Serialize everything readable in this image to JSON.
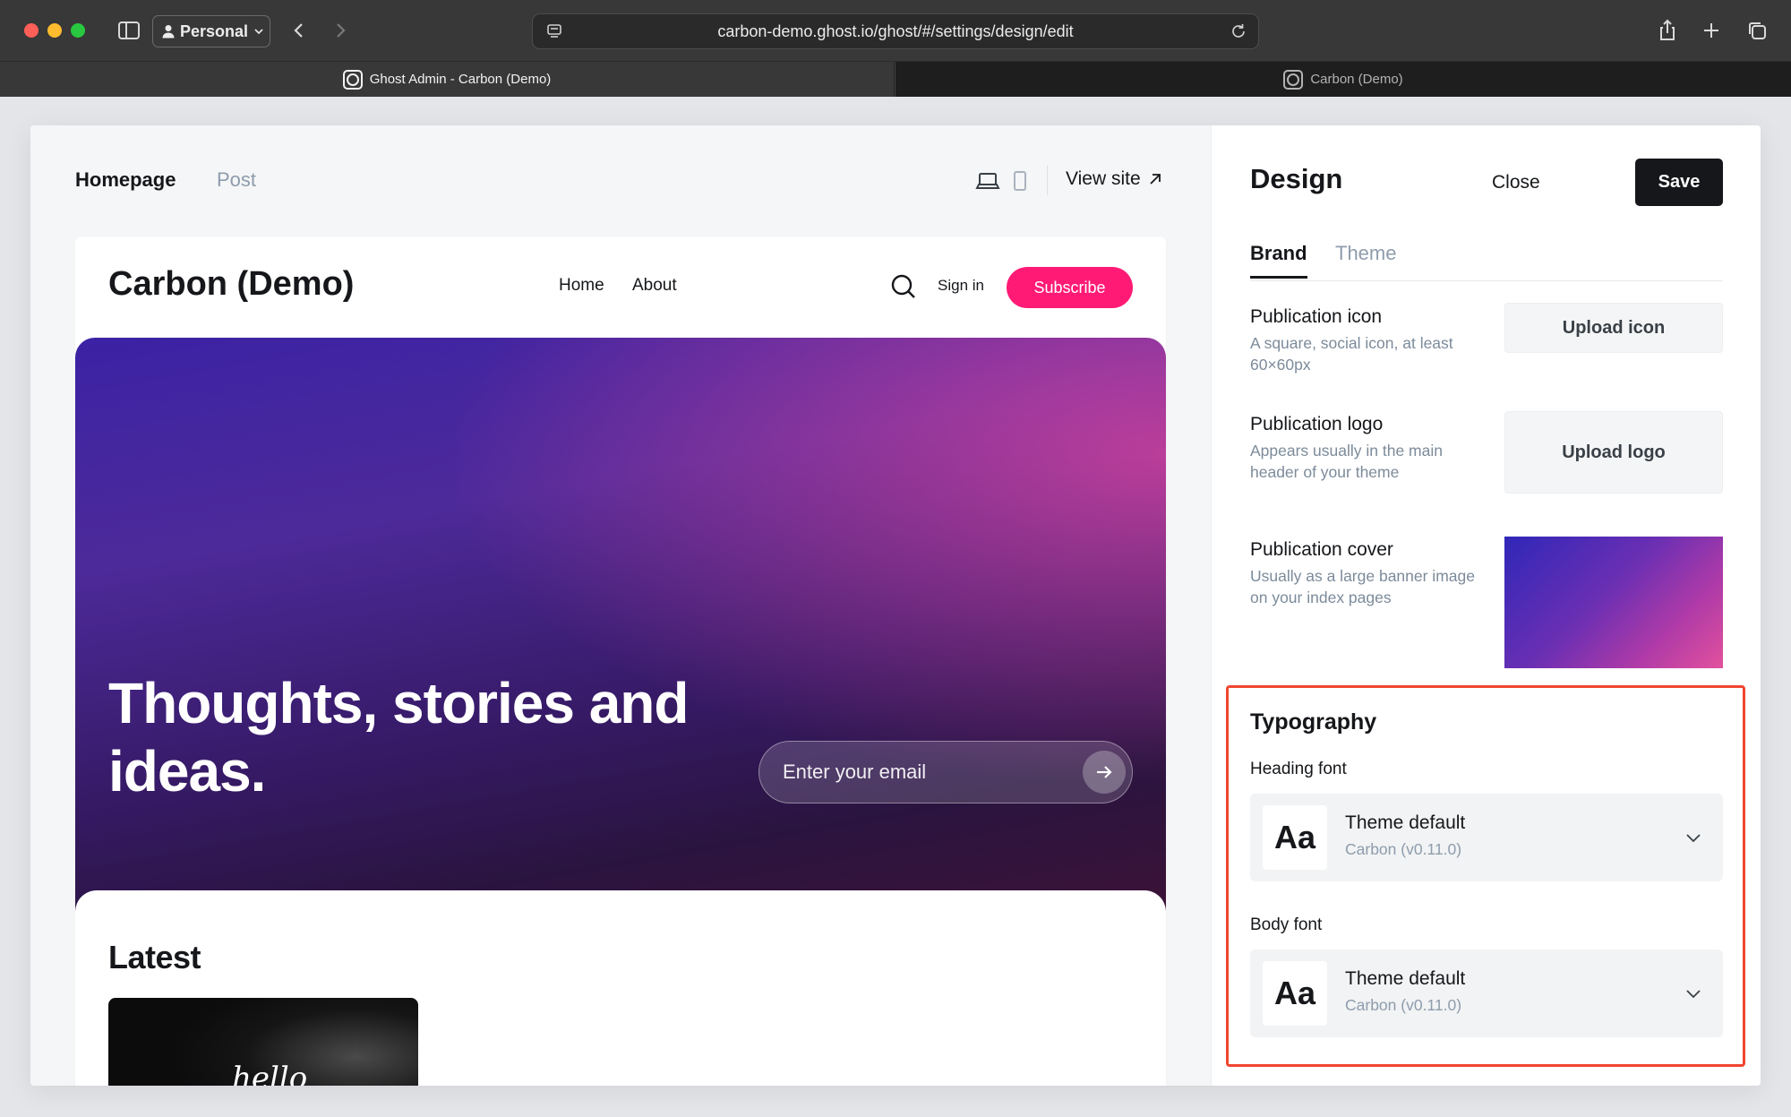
{
  "browser": {
    "profile": "Personal",
    "url": "carbon-demo.ghost.io/ghost/#/settings/design/edit",
    "tabs": [
      {
        "title": "Ghost Admin - Carbon (Demo)",
        "active": true
      },
      {
        "title": "Carbon (Demo)",
        "active": false
      }
    ]
  },
  "preview_toolbar": {
    "tabs": [
      "Homepage",
      "Post"
    ],
    "view_site": "View site"
  },
  "site": {
    "title": "Carbon (Demo)",
    "nav": [
      "Home",
      "About"
    ],
    "signin": "Sign in",
    "subscribe": "Subscribe",
    "hero_title": "Thoughts, stories and ideas.",
    "email_placeholder": "Enter your email",
    "latest_title": "Latest",
    "card_script": "hello"
  },
  "design": {
    "title": "Design",
    "close": "Close",
    "save": "Save",
    "tabs": [
      "Brand",
      "Theme"
    ],
    "settings": [
      {
        "label": "Publication icon",
        "desc": "A square, social icon, at least 60×60px",
        "action": "Upload icon"
      },
      {
        "label": "Publication logo",
        "desc": "Appears usually in the main header of your theme",
        "action": "Upload logo"
      },
      {
        "label": "Publication cover",
        "desc": "Usually as a large banner image on your index pages"
      }
    ],
    "typography": {
      "title": "Typography",
      "heading_font": {
        "label": "Heading font",
        "sample": "Aa",
        "name": "Theme default",
        "sub": "Carbon (v0.11.0)"
      },
      "body_font": {
        "label": "Body font",
        "sample": "Aa",
        "name": "Theme default",
        "sub": "Carbon (v0.11.0)"
      }
    }
  },
  "colors": {
    "accent": "#ff1a75",
    "highlight": "#f0452f",
    "save_bg": "#15171a"
  }
}
